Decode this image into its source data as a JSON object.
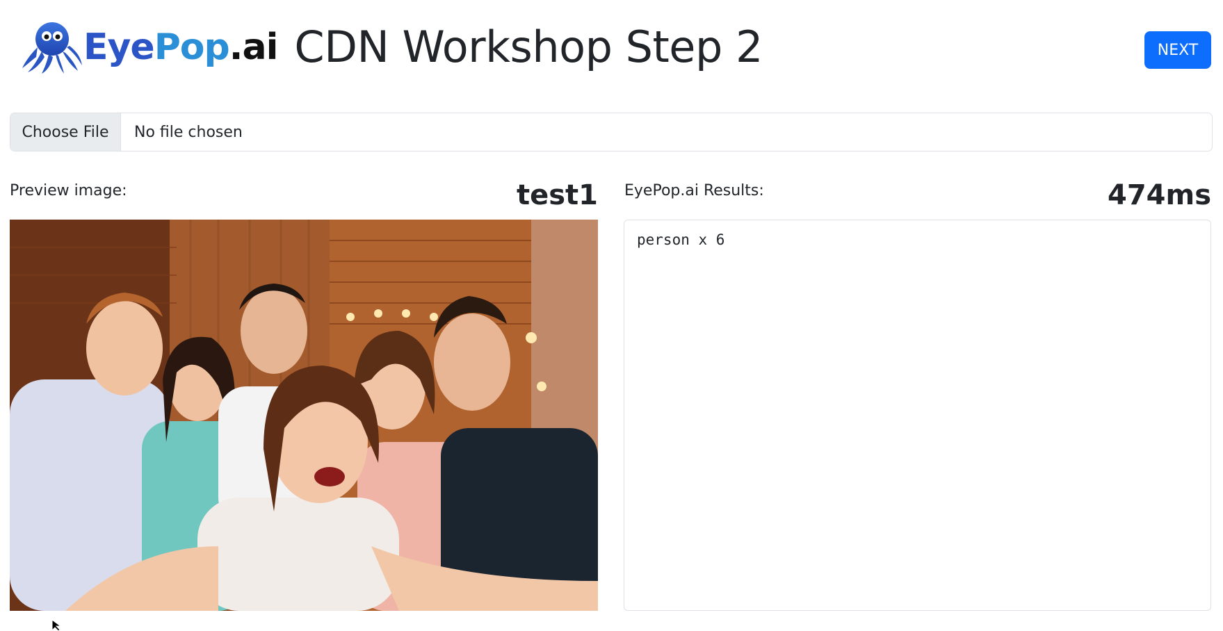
{
  "header": {
    "logo": {
      "part1": "Eye",
      "part2": "Pop",
      "part3": ".ai"
    },
    "title": "CDN Workshop Step 2",
    "next_label": "NEXT"
  },
  "file_input": {
    "button_label": "Choose File",
    "status": "No file chosen"
  },
  "preview": {
    "label": "Preview image:",
    "name": "test1"
  },
  "results": {
    "label": "EyePop.ai Results:",
    "timing": "474ms",
    "output": "person x 6"
  },
  "colors": {
    "primary": "#0d6efd",
    "logo_blue_dark": "#2b54c6",
    "logo_blue_light": "#2a8fd6",
    "text": "#212529",
    "border": "#dee2e6"
  }
}
